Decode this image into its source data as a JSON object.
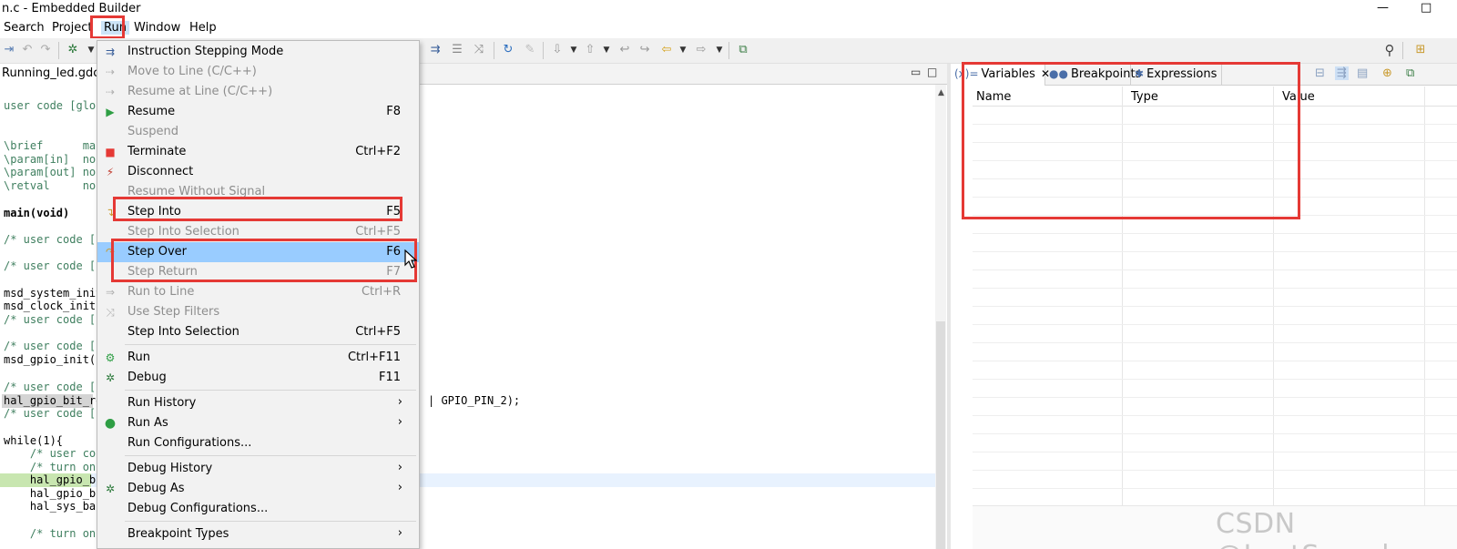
{
  "window": {
    "title": "n.c - Embedded Builder",
    "minimize": "—",
    "maximize": "□"
  },
  "menubar": {
    "items": [
      "Search",
      "Project",
      "Run",
      "Window",
      "Help"
    ]
  },
  "editor": {
    "tab_label": "Running_led.gdc",
    "lines": [
      "user code [global",
      "",
      "\\brief      mai",
      "\\param[in]  non",
      "\\param[out] non",
      "\\retval     non",
      "",
      "main(void)",
      "",
      "/* user code [",
      "",
      "/* user code [",
      "",
      "msd_system_init",
      "msd_clock_init(",
      "/* user code [",
      "",
      "/* user code [",
      "msd_gpio_init(",
      "",
      "/* user code [",
      "hal_gpio_bit_re",
      "/* user code [",
      "",
      "while(1){",
      "    /* user coc",
      "    /* turn on",
      "    hal_gpio_bi",
      "    hal_gpio_bi",
      "    hal_sys_bas",
      "",
      "    /* turn on"
    ],
    "continuation_text": "| GPIO_PIN_2);"
  },
  "run_menu": {
    "items": [
      {
        "label": "Instruction Stepping Mode",
        "shortcut": "",
        "icon": "instruction-stepping-icon",
        "disabled": false
      },
      {
        "label": "Move to Line (C/C++)",
        "shortcut": "",
        "icon": "move-to-line-icon",
        "disabled": true
      },
      {
        "label": "Resume at Line (C/C++)",
        "shortcut": "",
        "icon": "resume-at-line-icon",
        "disabled": true
      },
      {
        "label": "Resume",
        "shortcut": "F8",
        "icon": "resume-icon",
        "disabled": false
      },
      {
        "label": "Suspend",
        "shortcut": "",
        "icon": "suspend-icon",
        "disabled": true
      },
      {
        "label": "Terminate",
        "shortcut": "Ctrl+F2",
        "icon": "terminate-icon",
        "disabled": false
      },
      {
        "label": "Disconnect",
        "shortcut": "",
        "icon": "disconnect-icon",
        "disabled": false
      },
      {
        "label": "Resume Without Signal",
        "shortcut": "",
        "icon": "resume-without-signal-icon",
        "disabled": true
      },
      {
        "label": "Step Into",
        "shortcut": "F5",
        "icon": "step-into-icon",
        "disabled": false
      },
      {
        "label": "Step Into Selection",
        "shortcut": "Ctrl+F5",
        "icon": "",
        "disabled": true
      },
      {
        "label": "Step Over",
        "shortcut": "F6",
        "icon": "step-over-icon",
        "disabled": false
      },
      {
        "label": "Step Return",
        "shortcut": "F7",
        "icon": "",
        "disabled": true
      },
      {
        "label": "Run to Line",
        "shortcut": "Ctrl+R",
        "icon": "run-to-line-icon",
        "disabled": true
      },
      {
        "label": "Use Step Filters",
        "shortcut": "",
        "icon": "step-filters-icon",
        "disabled": true
      },
      {
        "label": "Step Into Selection",
        "shortcut": "Ctrl+F5",
        "icon": "",
        "disabled": false
      },
      {
        "label": "Run",
        "shortcut": "Ctrl+F11",
        "icon": "run-icon",
        "disabled": false
      },
      {
        "label": "Debug",
        "shortcut": "F11",
        "icon": "debug-icon",
        "disabled": false
      },
      {
        "label": "Run History",
        "shortcut": "",
        "icon": "",
        "disabled": false,
        "submenu": true
      },
      {
        "label": "Run As",
        "shortcut": "",
        "icon": "run-as-icon",
        "disabled": false,
        "submenu": true
      },
      {
        "label": "Run Configurations...",
        "shortcut": "",
        "icon": "",
        "disabled": false
      },
      {
        "label": "Debug History",
        "shortcut": "",
        "icon": "",
        "disabled": false,
        "submenu": true
      },
      {
        "label": "Debug As",
        "shortcut": "",
        "icon": "debug-as-icon",
        "disabled": false,
        "submenu": true
      },
      {
        "label": "Debug Configurations...",
        "shortcut": "",
        "icon": "",
        "disabled": false
      },
      {
        "label": "Breakpoint Types",
        "shortcut": "",
        "icon": "",
        "disabled": false,
        "submenu": true
      }
    ],
    "selected": "Step Over",
    "submenu_arrow": "›"
  },
  "right_panel": {
    "tabs": [
      {
        "label": "Variables",
        "icon": "(x)=",
        "active": true,
        "close": "✕"
      },
      {
        "label": "Breakpoints",
        "icon": "●●",
        "active": false
      },
      {
        "label": "Expressions",
        "icon": "✱",
        "active": false
      }
    ],
    "columns": [
      "Name",
      "Type",
      "Value"
    ]
  },
  "watermark": "CSDN @LostSpeed",
  "colors": {
    "annotation_red": "#e53935",
    "menu_selected": "#99ccff"
  }
}
